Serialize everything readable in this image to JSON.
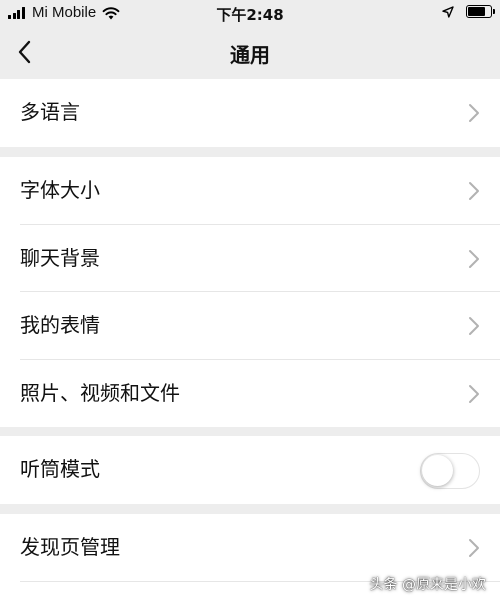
{
  "status_bar": {
    "carrier": "Mi Mobile",
    "time": "下午2:48"
  },
  "nav": {
    "title": "通用"
  },
  "groups": [
    {
      "items": [
        {
          "label": "多语言"
        }
      ]
    },
    {
      "items": [
        {
          "label": "字体大小"
        },
        {
          "label": "聊天背景"
        },
        {
          "label": "我的表情"
        },
        {
          "label": "照片、视频和文件"
        }
      ]
    },
    {
      "items": [
        {
          "label": "听筒模式",
          "toggle_on": false
        }
      ]
    },
    {
      "items": [
        {
          "label": "发现页管理"
        }
      ]
    }
  ],
  "watermark": "头条 @原来是小欢",
  "colors": {
    "background": "#ededed",
    "card": "#ffffff",
    "chevron": "#b2b2b2"
  }
}
